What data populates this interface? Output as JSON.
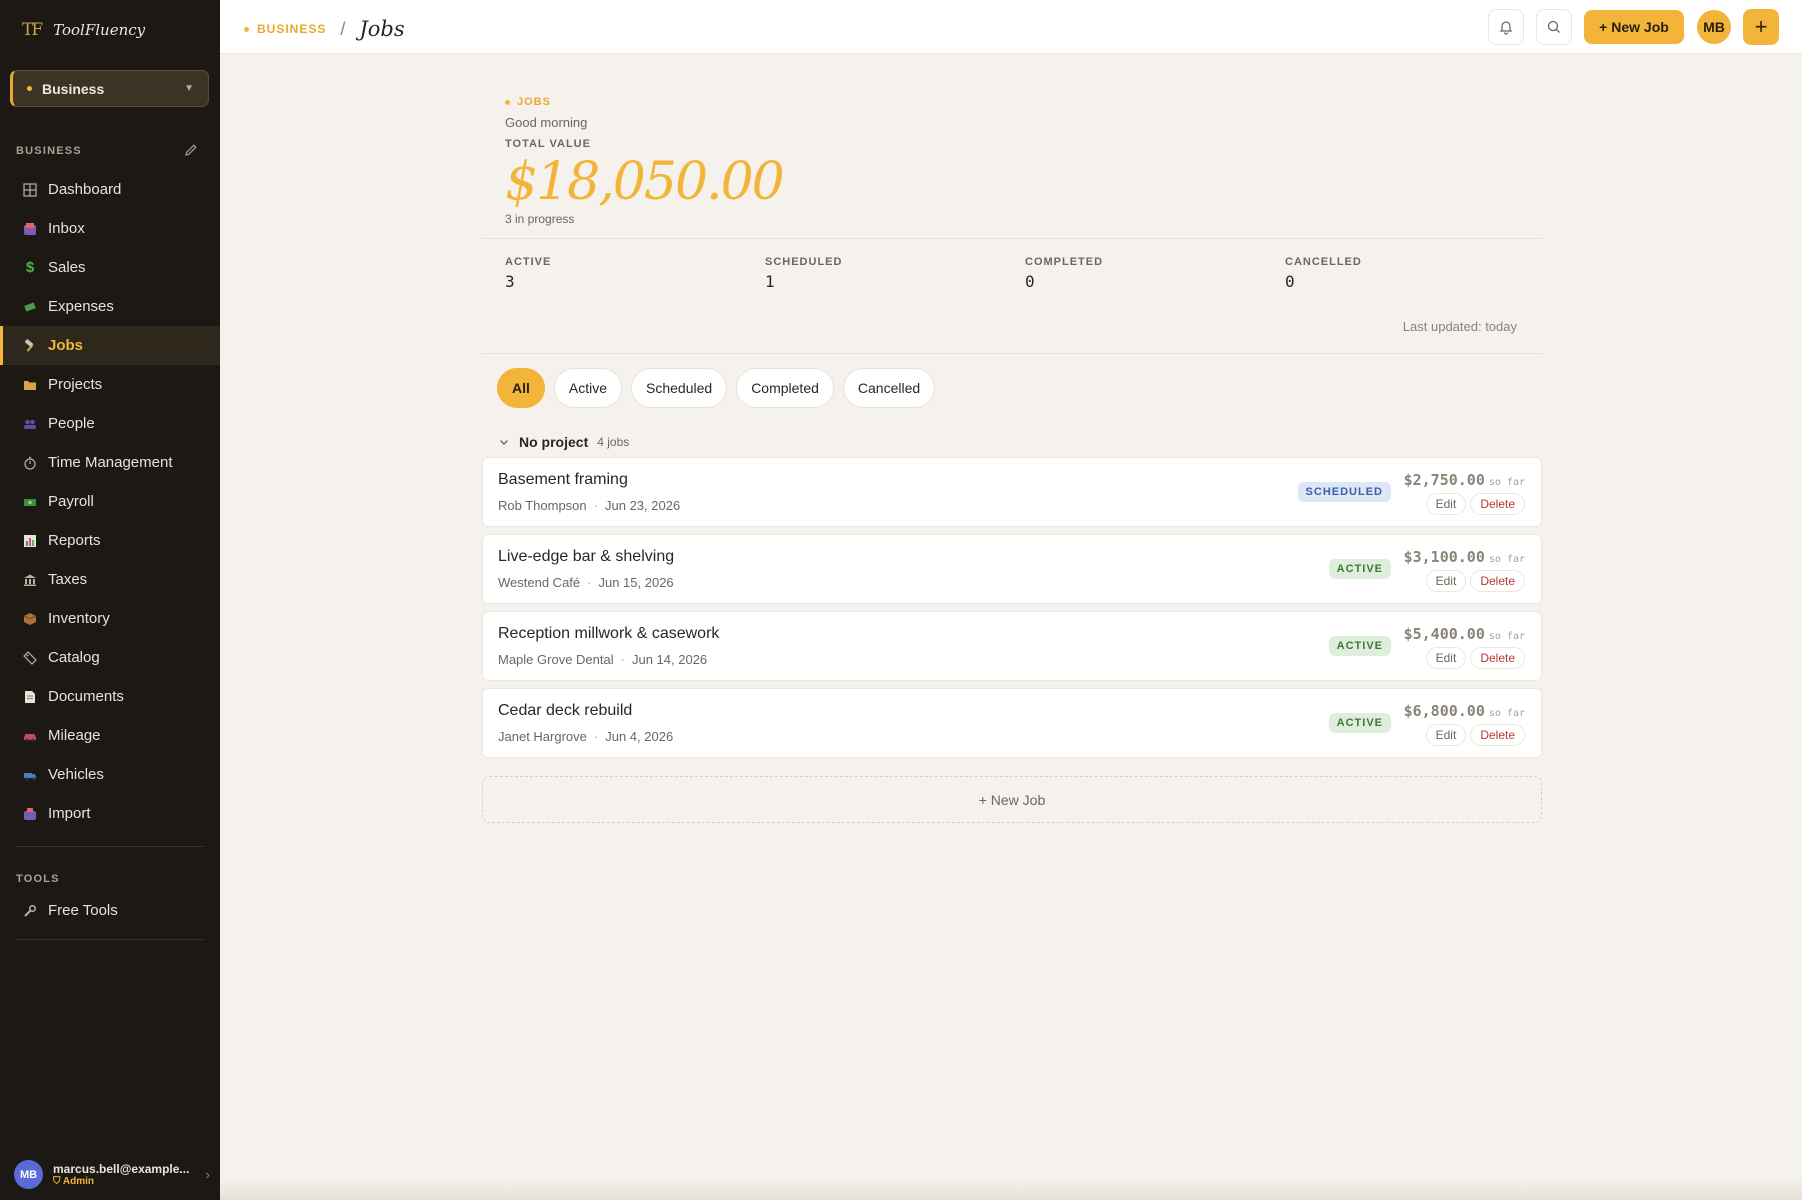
{
  "sidebar": {
    "brand_mark": "TF",
    "brand_name": "ToolFluency",
    "business_select": "Business",
    "section_business": "BUSINESS",
    "items": [
      {
        "label": "Dashboard",
        "icon": "grid-icon"
      },
      {
        "label": "Inbox",
        "icon": "inbox-icon"
      },
      {
        "label": "Sales",
        "icon": "dollar-icon"
      },
      {
        "label": "Expenses",
        "icon": "money-wings-icon"
      },
      {
        "label": "Jobs",
        "icon": "hammer-icon"
      },
      {
        "label": "Projects",
        "icon": "folder-icon"
      },
      {
        "label": "People",
        "icon": "people-icon"
      },
      {
        "label": "Time Management",
        "icon": "stopwatch-icon"
      },
      {
        "label": "Payroll",
        "icon": "cash-icon"
      },
      {
        "label": "Reports",
        "icon": "bar-chart-icon"
      },
      {
        "label": "Taxes",
        "icon": "bank-icon"
      },
      {
        "label": "Inventory",
        "icon": "box-icon"
      },
      {
        "label": "Catalog",
        "icon": "tag-icon"
      },
      {
        "label": "Documents",
        "icon": "document-icon"
      },
      {
        "label": "Mileage",
        "icon": "car-icon"
      },
      {
        "label": "Vehicles",
        "icon": "truck-icon"
      },
      {
        "label": "Import",
        "icon": "import-icon"
      }
    ],
    "section_tools": "TOOLS",
    "tools_item": "Free Tools",
    "user": {
      "initials": "MB",
      "email": "marcus.bell@example...",
      "role": "Admin"
    }
  },
  "topbar": {
    "crumb_section": "BUSINESS",
    "crumb_separator": "/",
    "page_title": "Jobs",
    "new_job_label": "+ New Job",
    "avatar_initials": "MB",
    "plus_label": "+"
  },
  "hero": {
    "kicker": "JOBS",
    "greeting": "Good morning",
    "total_label": "TOTAL VALUE",
    "total_value": "$18,050.00",
    "subtitle": "3 in progress"
  },
  "stats": [
    {
      "label": "ACTIVE",
      "value": "3"
    },
    {
      "label": "SCHEDULED",
      "value": "1"
    },
    {
      "label": "COMPLETED",
      "value": "0"
    },
    {
      "label": "CANCELLED",
      "value": "0"
    }
  ],
  "last_updated": "Last updated: today",
  "filters": [
    "All",
    "Active",
    "Scheduled",
    "Completed",
    "Cancelled"
  ],
  "group": {
    "name": "No project",
    "count": "4 jobs"
  },
  "jobs": [
    {
      "title": "Basement framing",
      "client": "Rob Thompson",
      "date": "Jun 23, 2026",
      "status": "SCHEDULED",
      "amount": "$2,750.00",
      "so_far": "so far",
      "edit": "Edit",
      "delete": "Delete"
    },
    {
      "title": "Live-edge bar & shelving",
      "client": "Westend Café",
      "date": "Jun 15, 2026",
      "status": "ACTIVE",
      "amount": "$3,100.00",
      "so_far": "so far",
      "edit": "Edit",
      "delete": "Delete"
    },
    {
      "title": "Reception millwork & casework",
      "client": "Maple Grove Dental",
      "date": "Jun 14, 2026",
      "status": "ACTIVE",
      "amount": "$5,400.00",
      "so_far": "so far",
      "edit": "Edit",
      "delete": "Delete"
    },
    {
      "title": "Cedar deck rebuild",
      "client": "Janet Hargrove",
      "date": "Jun 4, 2026",
      "status": "ACTIVE",
      "amount": "$6,800.00",
      "so_far": "so far",
      "edit": "Edit",
      "delete": "Delete"
    }
  ],
  "new_job_row": "+ New Job",
  "colors": {
    "accent": "#f2b53a",
    "sidebar_bg": "#1c1915",
    "page_bg": "#f5f2ed",
    "danger": "#b53a2e",
    "active_badge": "#dfeedc",
    "scheduled_badge": "#dde7f5"
  }
}
